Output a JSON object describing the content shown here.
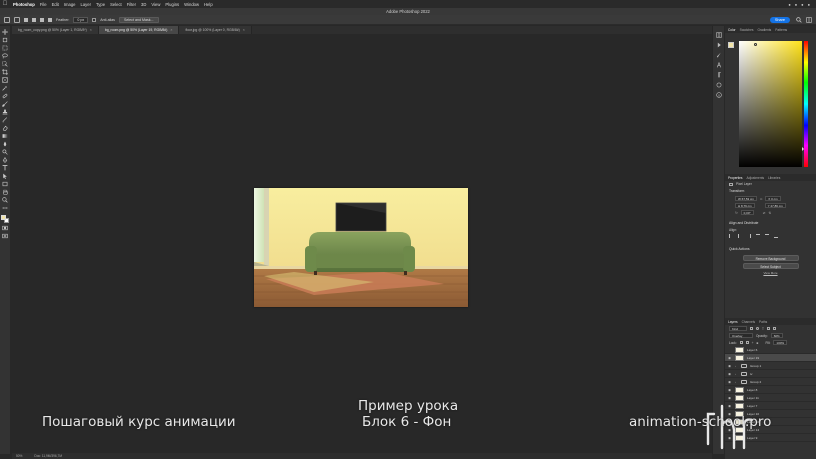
{
  "menubar": {
    "app_name": "Photoshop",
    "items": [
      "File",
      "Edit",
      "Image",
      "Layer",
      "Type",
      "Select",
      "Filter",
      "3D",
      "View",
      "Plugins",
      "Window",
      "Help"
    ]
  },
  "window": {
    "title": "Adobe Photoshop 2022"
  },
  "options_bar": {
    "feather_label": "Feather:",
    "feather_value": "0 px",
    "anti_alias_label": "Anti-alias",
    "select_mask_label": "Select and Mask...",
    "share_label": "Share"
  },
  "tabs": [
    {
      "label": "bg_room_copy.png @ 50% (Layer 1, RGB/8*)",
      "active": false
    },
    {
      "label": "bg_room.png @ 50% (Layer 19, RGB/8#)",
      "active": true
    },
    {
      "label": "floor.jpg @ 100% (Layer 0, RGB/8#)",
      "active": false
    }
  ],
  "status_bar": {
    "zoom": "50%",
    "doc_info": "Doc: 11,9M/396,7M"
  },
  "color_panel": {
    "tabs": [
      "Color",
      "Swatches",
      "Gradients",
      "Patterns"
    ],
    "foreground": "#f1e4a7",
    "background": "#ffffff"
  },
  "properties_panel": {
    "tabs": [
      "Properties",
      "Adjustments",
      "Libraries"
    ],
    "layer_type": "Pixel Layer",
    "transform_title": "Transform",
    "w": "W 67,53 cm",
    "h": "H 8,79 cm",
    "x": "X 0 cm",
    "y": "Y 27,86 cm",
    "angle": "0,00°",
    "align_title": "Align and Distribute",
    "align_sub": "Align:",
    "quick_actions_title": "Quick Actions",
    "remove_bg": "Remove Background",
    "select_subject": "Select Subject",
    "view_more": "View More"
  },
  "layers_panel": {
    "tabs": [
      "Layers",
      "Channels",
      "Paths"
    ],
    "kind": "Kind",
    "blend_mode": "Overlay",
    "opacity_label": "Opacity:",
    "opacity": "60%",
    "lock_label": "Lock:",
    "fill_label": "Fill:",
    "fill": "100%",
    "layers": [
      {
        "name": "Layer 6",
        "type": "layer",
        "visible": false,
        "selected": false
      },
      {
        "name": "Layer 19",
        "type": "layer",
        "visible": true,
        "selected": true
      },
      {
        "name": "Group 1",
        "type": "group",
        "visible": true,
        "selected": false
      },
      {
        "name": "tv",
        "type": "group",
        "visible": true,
        "selected": false
      },
      {
        "name": "Group 2",
        "type": "group",
        "visible": true,
        "selected": false
      },
      {
        "name": "Layer 8",
        "type": "layer",
        "visible": true,
        "selected": false
      },
      {
        "name": "Layer 11",
        "type": "layer",
        "visible": true,
        "selected": false
      },
      {
        "name": "Layer 7",
        "type": "layer",
        "visible": true,
        "selected": false
      },
      {
        "name": "Layer 10",
        "type": "layer",
        "visible": true,
        "selected": false
      },
      {
        "name": "Layer 16",
        "type": "layer",
        "visible": true,
        "selected": false
      },
      {
        "name": "Layer 14",
        "type": "layer",
        "visible": true,
        "selected": false
      },
      {
        "name": "Layer 9",
        "type": "layer",
        "visible": true,
        "selected": false
      }
    ]
  },
  "overlay": {
    "course_title": "Пошаговый курс анимации",
    "lesson_line1": "Пример урока",
    "lesson_line2": "Блок 6 - Фон",
    "site": "animation-school.pro"
  }
}
